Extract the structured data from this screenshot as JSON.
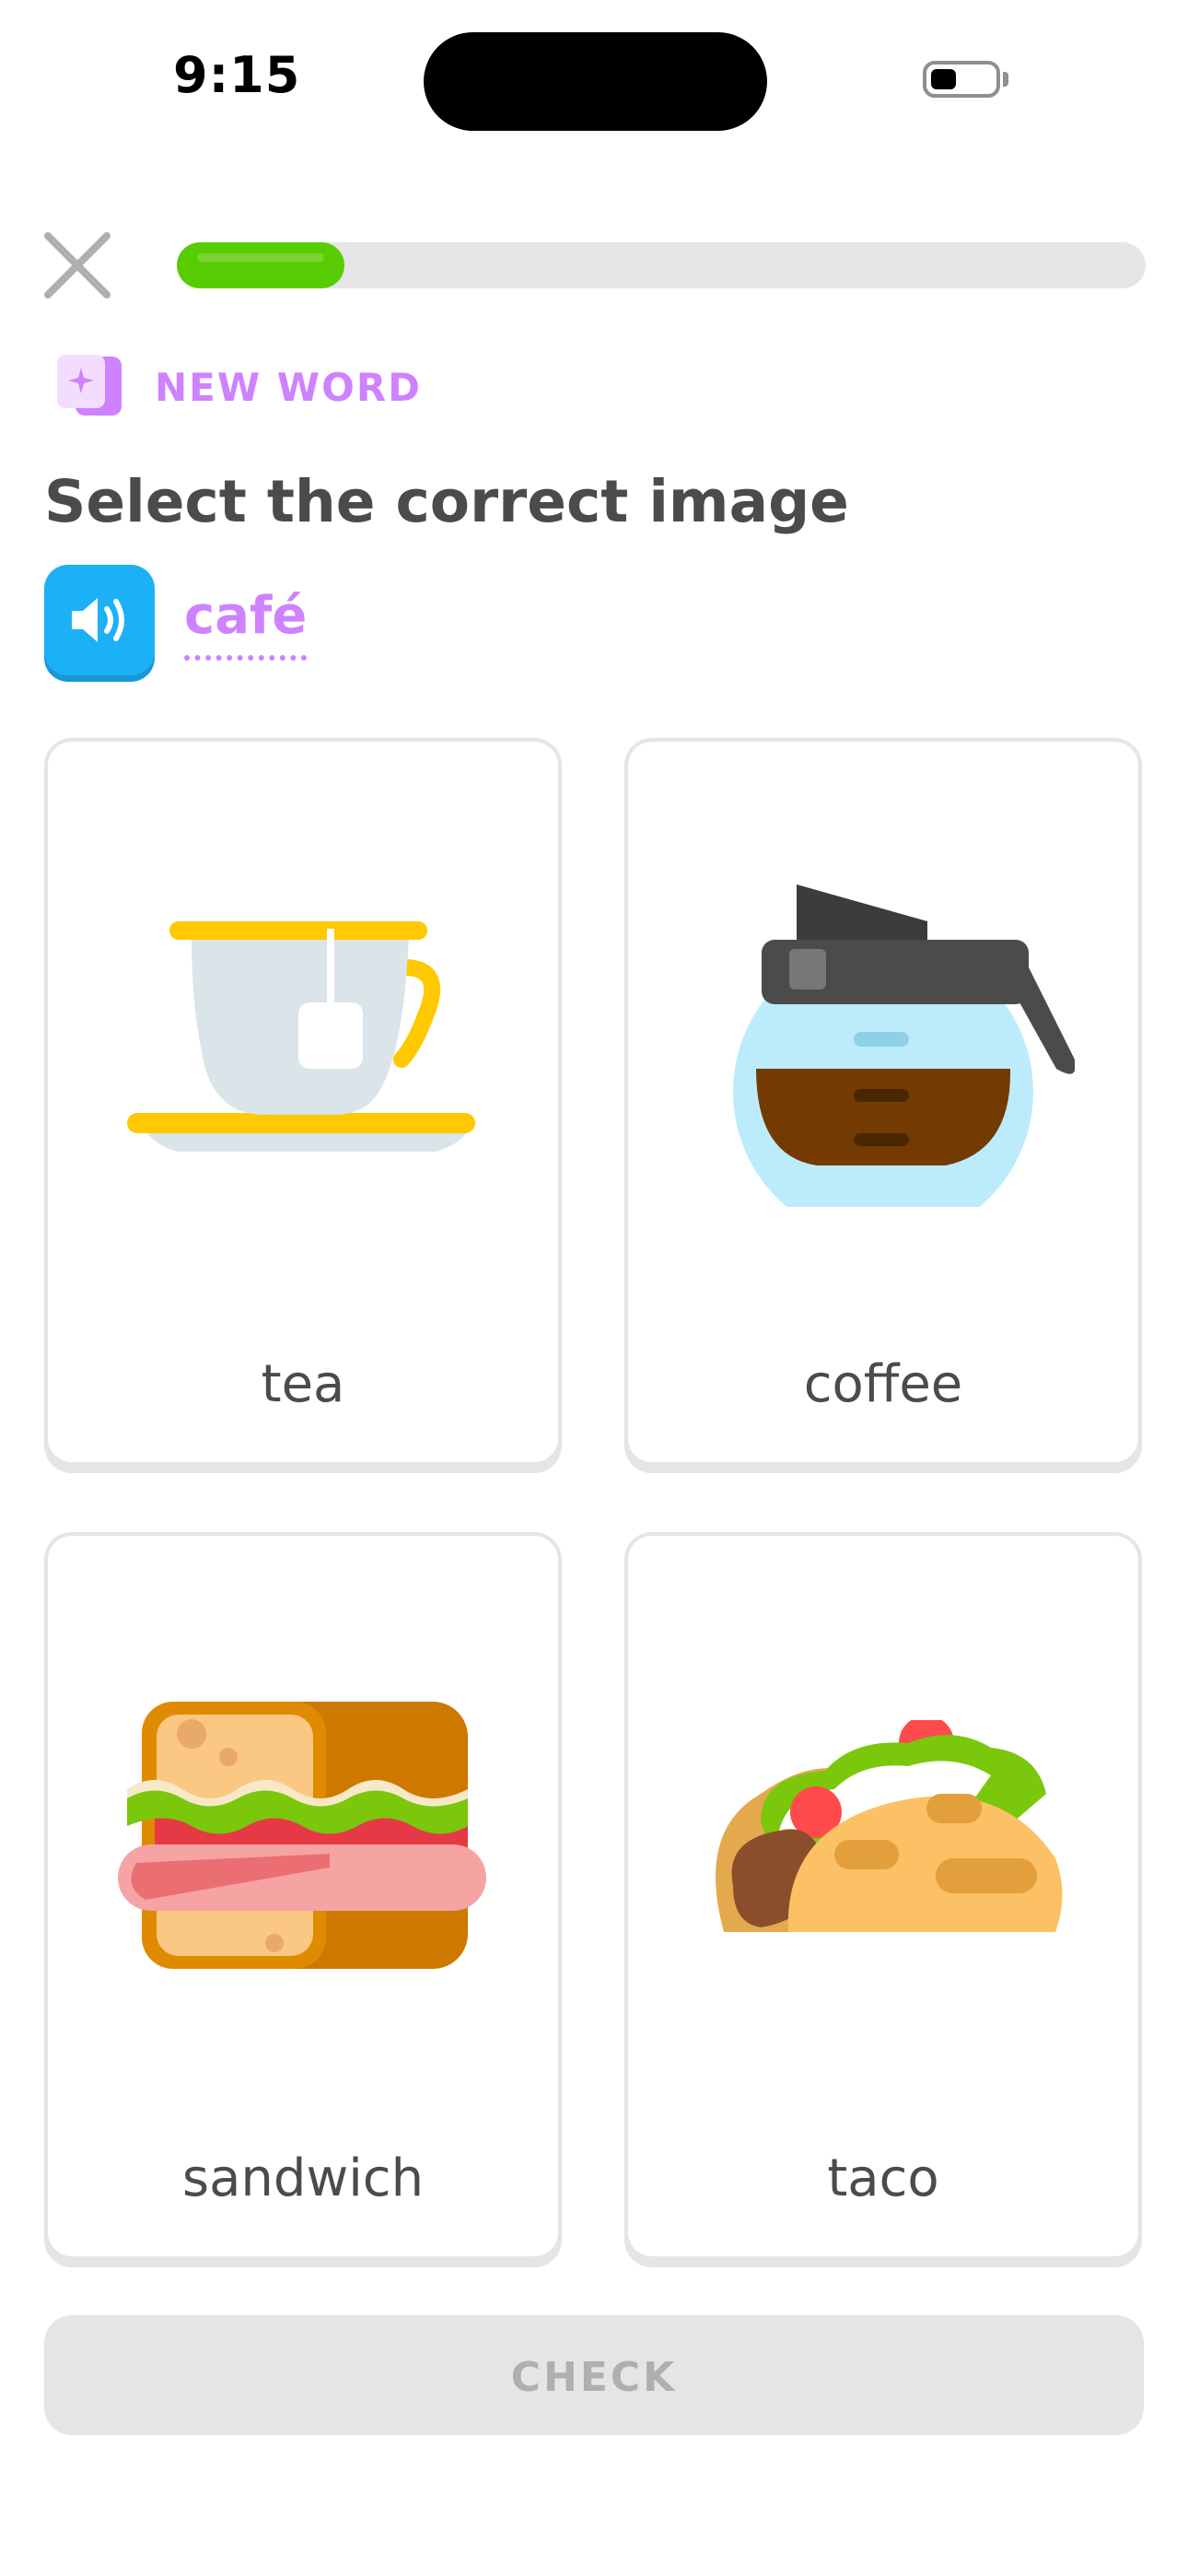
{
  "status_bar": {
    "time": "9:15",
    "battery_level": 0.4
  },
  "header": {
    "progress": 0.15
  },
  "badge": {
    "label": "NEW WORD",
    "icon": "new-word-card-icon"
  },
  "prompt": {
    "title": "Select the correct image",
    "word": "café"
  },
  "choices": [
    {
      "label": "tea",
      "icon": "tea-cup-icon"
    },
    {
      "label": "coffee",
      "icon": "coffee-pot-icon"
    },
    {
      "label": "sandwich",
      "icon": "sandwich-icon"
    },
    {
      "label": "taco",
      "icon": "taco-icon"
    }
  ],
  "footer": {
    "check_label": "CHECK"
  },
  "colors": {
    "accent": "#ce82ff",
    "progress": "#58cc02",
    "speaker": "#1cb0f6",
    "disabled": "#e5e5e5"
  }
}
